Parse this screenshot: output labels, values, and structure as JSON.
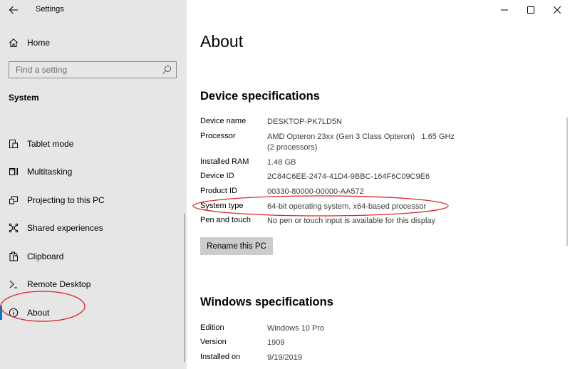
{
  "window": {
    "title": "Settings",
    "controls": [
      "minimize",
      "maximize",
      "close"
    ]
  },
  "sidebar": {
    "home_label": "Home",
    "search_placeholder": "Find a setting",
    "section": "System",
    "items": [
      {
        "label": "Tablet mode",
        "icon": "tablet-icon"
      },
      {
        "label": "Multitasking",
        "icon": "multitasking-icon"
      },
      {
        "label": "Projecting to this PC",
        "icon": "projecting-icon"
      },
      {
        "label": "Shared experiences",
        "icon": "shared-experiences-icon"
      },
      {
        "label": "Clipboard",
        "icon": "clipboard-icon"
      },
      {
        "label": "Remote Desktop",
        "icon": "remote-desktop-icon"
      },
      {
        "label": "About",
        "icon": "info-icon",
        "selected": true
      }
    ]
  },
  "main": {
    "title": "About",
    "device_specs": {
      "heading": "Device specifications",
      "rows": [
        {
          "key": "Device name",
          "value": "DESKTOP-PK7LD5N"
        },
        {
          "key": "Processor",
          "value": "AMD Opteron 23xx (Gen 3 Class Opteron)   1.65 GHz",
          "value2": "(2 processors)"
        },
        {
          "key": "Installed RAM",
          "value": "1.48 GB"
        },
        {
          "key": "Device ID",
          "value": "2C84C6EE-2474-41D4-9BBC-164F6C09C9E6"
        },
        {
          "key": "Product ID",
          "value": "00330-80000-00000-AA572"
        },
        {
          "key": "System type",
          "value": "64-bit operating system, x64-based processor"
        },
        {
          "key": "Pen and touch",
          "value": "No pen or touch input is available for this display"
        }
      ],
      "rename_button": "Rename this PC"
    },
    "windows_specs": {
      "heading": "Windows specifications",
      "rows": [
        {
          "key": "Edition",
          "value": "Windows 10 Pro"
        },
        {
          "key": "Version",
          "value": "1909"
        },
        {
          "key": "Installed on",
          "value": "9/19/2019"
        }
      ]
    }
  },
  "colors": {
    "sidebar_bg": "#e6e6e6",
    "accent": "#0078d7",
    "annotation": "#d9262c"
  }
}
